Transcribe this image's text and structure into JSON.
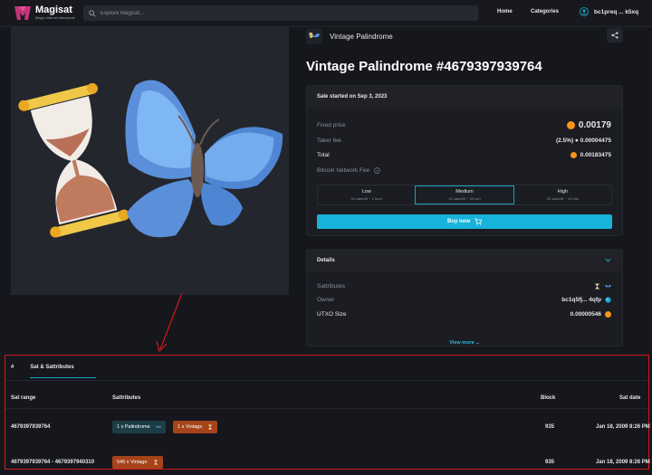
{
  "nav": {
    "brand": "Magisat",
    "tagline": "Magic internet diamonds",
    "search_placeholder": "Explore Magisat...",
    "links": [
      "Home",
      "Categories"
    ],
    "wallet": "bc1preq ... k5xq"
  },
  "collection": {
    "name": "Vintage Palindrome"
  },
  "item": {
    "title": "Vintage Palindrome #4679397939764"
  },
  "sale": {
    "header": "Sale started on Sep 3, 2023",
    "fixed_price_label": "Fixed price",
    "fixed_price": "0.00179",
    "taker_fee_label": "Taker fee",
    "taker_fee": "(2.5%) ● 0.00004475",
    "total_label": "Total",
    "total": "0.00183475",
    "network_fee_label": "Bitcoin Network Fee",
    "fee_options": [
      {
        "name": "Low",
        "detail": "32 sats/vB ~ 1 hour"
      },
      {
        "name": "Medium",
        "detail": "32 sats/vB ~ 30 min",
        "selected": true
      },
      {
        "name": "High",
        "detail": "32 sats/vB ~ 10 min"
      }
    ],
    "buy_label": "Buy now"
  },
  "details": {
    "header": "Details",
    "sattributes_label": "Sattributes",
    "owner_label": "Owner",
    "owner": "bc1q5fj... 4qfp",
    "utxo_label": "UTXO Size",
    "utxo": "0.00000546",
    "view_more": "View more ⌄"
  },
  "table": {
    "tabs": [
      "#",
      "Sat & Sattributes"
    ],
    "headers": [
      "Sat range",
      "Sattributes",
      "Block",
      "Sat date"
    ],
    "rows": [
      {
        "range": "4679397939764",
        "chips": [
          {
            "label": "1 x  Palindrome",
            "color": "#1d3d44",
            "icon": "palindrome-icon"
          },
          {
            "label": "1 x  Vintage",
            "color": "#a6431b",
            "icon": "hourglass-icon"
          }
        ],
        "block": "935",
        "date": "Jan 18, 2009 8:26 PM"
      },
      {
        "range": "4679397939764 - 4679397940310",
        "chips": [
          {
            "label": "546 x  Vintage",
            "color": "#a6431b",
            "icon": "hourglass-icon"
          }
        ],
        "block": "935",
        "date": "Jan 18, 2009 8:26 PM"
      }
    ]
  },
  "colors": {
    "accent": "#18b3db",
    "highlight_border": "#d41818",
    "bitcoin": "#f7931a"
  }
}
